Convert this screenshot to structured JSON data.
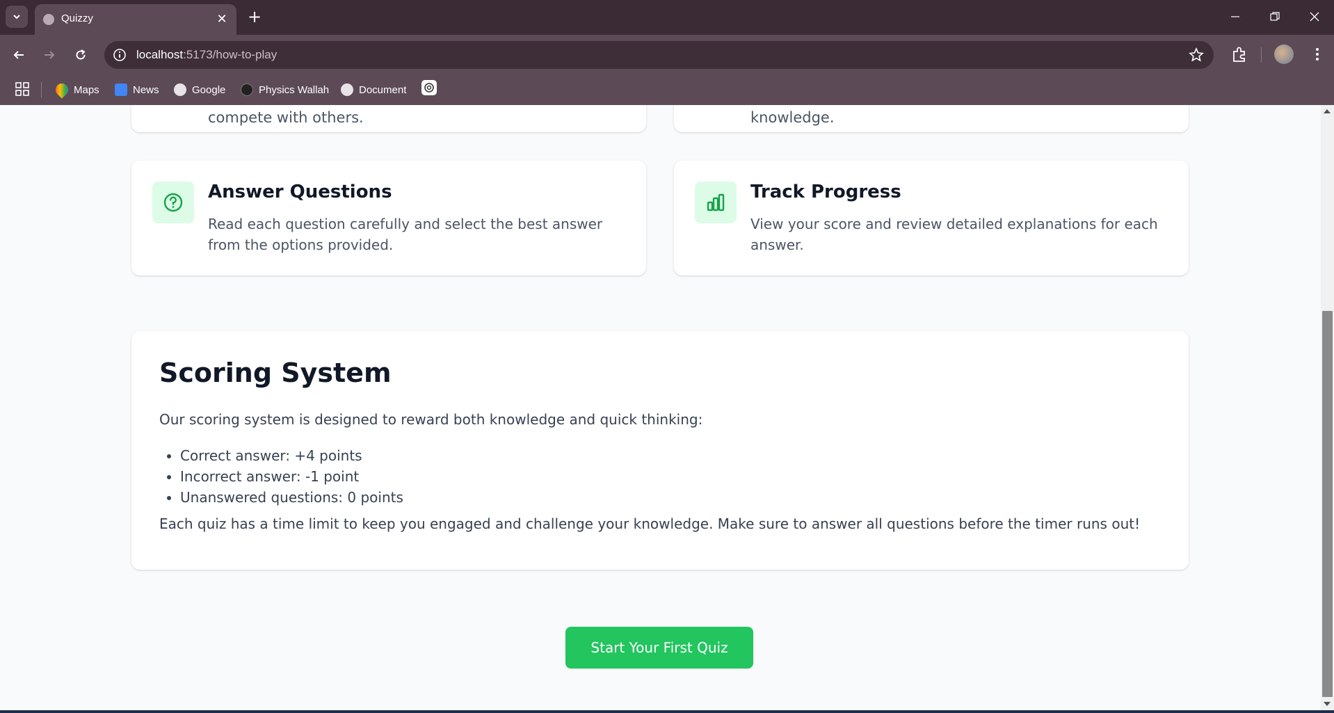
{
  "browser": {
    "tab_title": "Quizzy",
    "url_host": "localhost",
    "url_path": ":5173/how-to-play",
    "bookmarks": [
      {
        "label": "Maps",
        "icon": "maps-icon"
      },
      {
        "label": "News",
        "icon": "news-icon"
      },
      {
        "label": "Google",
        "icon": "globe-icon"
      },
      {
        "label": "Physics Wallah",
        "icon": "physics-wallah-icon"
      },
      {
        "label": "Document",
        "icon": "globe-icon"
      }
    ]
  },
  "top_cards": {
    "left_text": "compete with others.",
    "right_text": "knowledge."
  },
  "steps": [
    {
      "title": "Answer Questions",
      "description": "Read each question carefully and select the best answer from the options provided.",
      "icon": "question-circle-icon"
    },
    {
      "title": "Track Progress",
      "description": "View your score and review detailed explanations for each answer.",
      "icon": "bar-chart-icon"
    }
  ],
  "scoring": {
    "title": "Scoring System",
    "intro": "Our scoring system is designed to reward both knowledge and quick thinking:",
    "rules": [
      "Correct answer: +4 points",
      "Incorrect answer: -1 point",
      "Unanswered questions: 0 points"
    ],
    "footer": "Each quiz has a time limit to keep you engaged and challenge your knowledge. Make sure to answer all questions before the timer runs out!"
  },
  "cta": {
    "label": "Start Your First Quiz"
  },
  "colors": {
    "accent": "#22c55e",
    "accent_light": "#dcfce7",
    "chrome": "#5d4a57"
  }
}
